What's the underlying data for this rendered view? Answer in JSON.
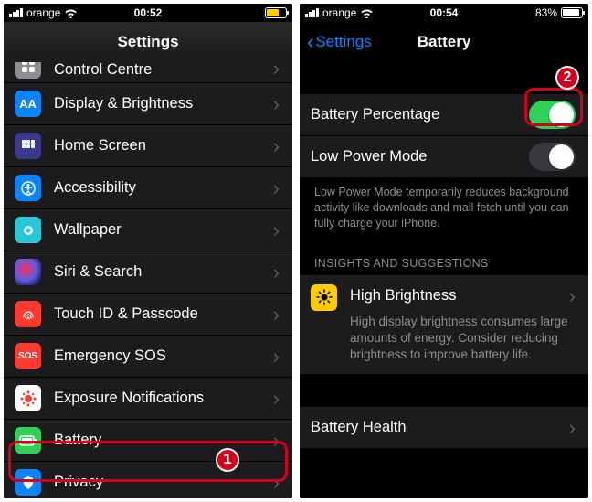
{
  "left": {
    "status": {
      "carrier": "orange",
      "time": "00:52"
    },
    "nav": {
      "title": "Settings"
    },
    "rows": [
      {
        "label": "Control Centre"
      },
      {
        "label": "Display & Brightness"
      },
      {
        "label": "Home Screen"
      },
      {
        "label": "Accessibility"
      },
      {
        "label": "Wallpaper"
      },
      {
        "label": "Siri & Search"
      },
      {
        "label": "Touch ID & Passcode"
      },
      {
        "label": "Emergency SOS"
      },
      {
        "label": "Exposure Notifications"
      },
      {
        "label": "Battery"
      },
      {
        "label": "Privacy"
      }
    ],
    "badge": "1"
  },
  "right": {
    "status": {
      "carrier": "orange",
      "time": "00:54",
      "pct": "83%"
    },
    "nav": {
      "back": "Settings",
      "title": "Battery"
    },
    "rows": {
      "battery_pct": "Battery Percentage",
      "low_power": "Low Power Mode",
      "low_power_foot": "Low Power Mode temporarily reduces background activity like downloads and mail fetch until you can fully charge your iPhone.",
      "insights_head": "INSIGHTS AND SUGGESTIONS",
      "high_brightness": "High Brightness",
      "high_brightness_desc": "High display brightness consumes large amounts of energy. Consider reducing brightness to improve battery life.",
      "battery_health": "Battery Health"
    },
    "badge": "2"
  }
}
